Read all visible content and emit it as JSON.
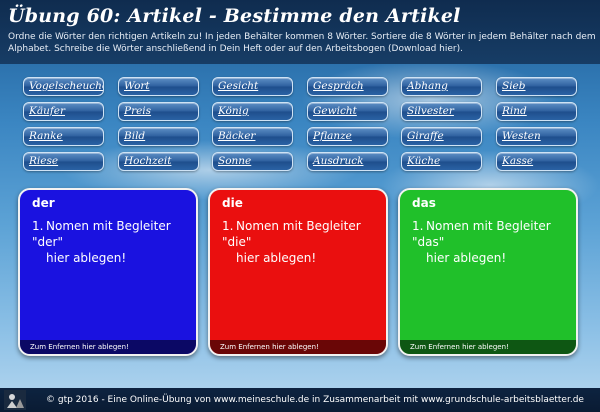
{
  "header": {
    "title": "Übung 60: Artikel - Bestimme den Artikel",
    "instructions": "Ordne die Wörter den richtigen Artikeln zu! In jeden Behälter kommen 8 Wörter. Sortiere die 8 Wörter in jedem Behälter nach dem Alphabet. Schreibe die Wörter anschließend in Dein Heft oder auf den Arbeitsbogen (Download hier)."
  },
  "words": [
    [
      "Vogelscheuche",
      "Wort",
      "Gesicht",
      "Gespräch",
      "Abhang",
      "Sieb"
    ],
    [
      "Käufer",
      "Preis",
      "König",
      "Gewicht",
      "Silvester",
      "Rind"
    ],
    [
      "Ranke",
      "Bild",
      "Bäcker",
      "Pflanze",
      "Giraffe",
      "Westen"
    ],
    [
      "Riese",
      "Hochzeit",
      "Sonne",
      "Ausdruck",
      "Küche",
      "Kasse"
    ]
  ],
  "bins": [
    {
      "label": "der",
      "item_num": "1.",
      "item_line1": "Nomen mit Begleiter \"der\"",
      "item_line2": "hier ablegen!",
      "remove_label": "Zum Enfernen hier ablegen!"
    },
    {
      "label": "die",
      "item_num": "1.",
      "item_line1": "Nomen mit Begleiter \"die\"",
      "item_line2": "hier ablegen!",
      "remove_label": "Zum Enfernen hier ablegen!"
    },
    {
      "label": "das",
      "item_num": "1.",
      "item_line1": "Nomen mit Begleiter \"das\"",
      "item_line2": "hier ablegen!",
      "remove_label": "Zum Enfernen hier ablegen!"
    }
  ],
  "footer": {
    "text": "© gtp 2016 - Eine Online-Übung von www.meineschule.de in Zusammenarbeit mit www.grundschule-arbeitsblaetter.de"
  },
  "colors": {
    "der": "#1a12e0",
    "die": "#ea0f0f",
    "das": "#20c02a"
  }
}
